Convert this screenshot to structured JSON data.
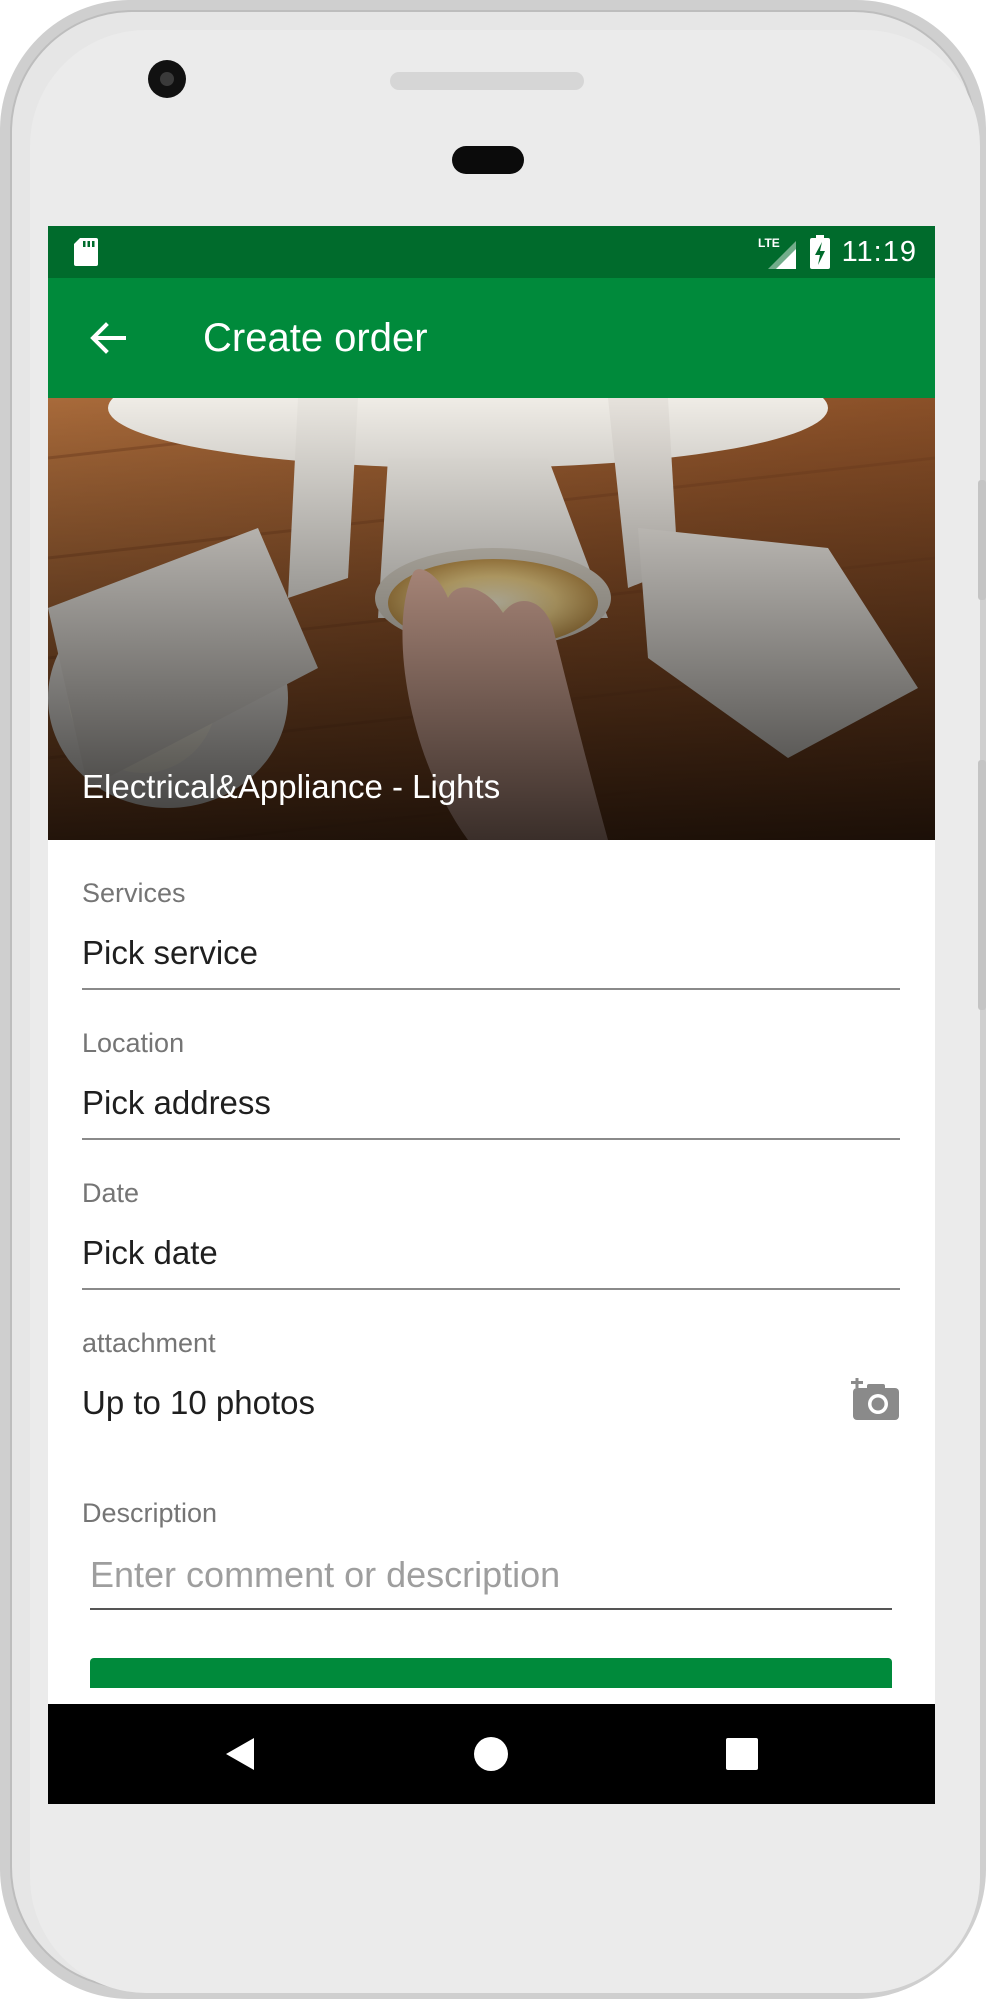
{
  "status_bar": {
    "time": "11:19",
    "network_label": "LTE"
  },
  "app_bar": {
    "title": "Create order"
  },
  "hero": {
    "caption": "Electrical&Appliance - Lights"
  },
  "form": {
    "services": {
      "label": "Services",
      "value": "Pick service"
    },
    "location": {
      "label": "Location",
      "value": "Pick address"
    },
    "date": {
      "label": "Date",
      "value": "Pick date"
    },
    "attachment": {
      "label": "attachment",
      "value": "Up to 10 photos"
    },
    "description": {
      "label": "Description",
      "placeholder": "Enter comment or description",
      "value": ""
    }
  },
  "icons": {
    "status_left": "sd-card-icon",
    "status_signal": "signal-lte-icon",
    "status_battery": "battery-charging-icon",
    "back": "arrow-back-icon",
    "attachment": "add-a-photo-icon",
    "nav_back": "triangle-back-icon",
    "nav_home": "circle-home-icon",
    "nav_recents": "square-recents-icon"
  },
  "colors": {
    "status_bar": "#006b2c",
    "app_bar": "#008a3b",
    "accent_button": "#008a3b",
    "nav_bar": "#000000"
  }
}
